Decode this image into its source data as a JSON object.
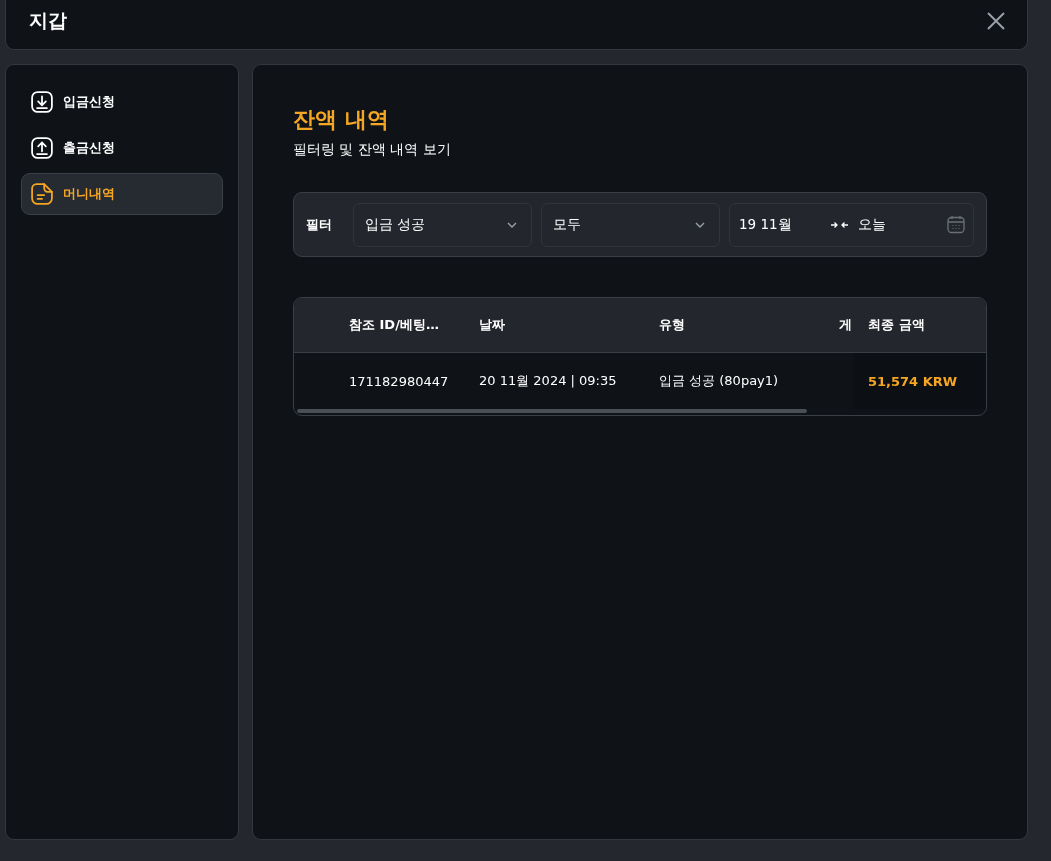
{
  "window": {
    "title": "지갑"
  },
  "sidebar": {
    "items": [
      {
        "label": "입금신청",
        "selected": false
      },
      {
        "label": "출금신청",
        "selected": false
      },
      {
        "label": "머니내역",
        "selected": true
      }
    ]
  },
  "page": {
    "title": "잔액 내역",
    "subtitle": "필터링 및 잔액 내역 보기"
  },
  "filter": {
    "label": "필터",
    "selects": [
      {
        "value": "입금 성공"
      },
      {
        "value": "모두"
      }
    ],
    "date_range": {
      "start": "19 11월",
      "end": "오늘"
    }
  },
  "table": {
    "columns": [
      "참조 ID/베팅…",
      "날짜",
      "유형",
      "게",
      "최종 금액"
    ],
    "rows": [
      [
        "171182980447",
        "20 11월 2024 | 09:35",
        "입금 성공 (80pay1)",
        "",
        "51,574 KRW"
      ]
    ]
  }
}
